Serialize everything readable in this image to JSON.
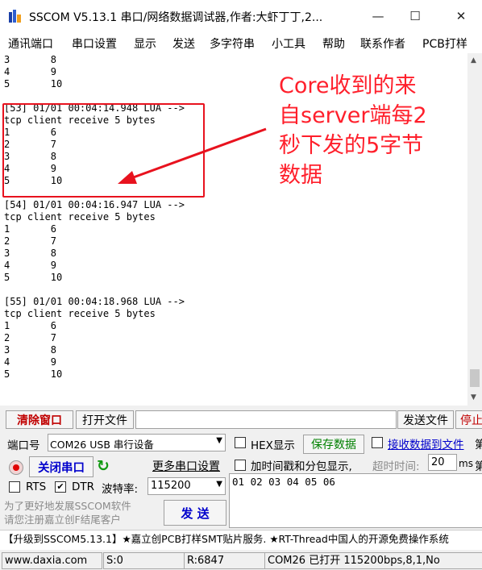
{
  "window": {
    "title": "SSCOM V5.13.1 串口/网络数据调试器,作者:大虾丁丁,2..."
  },
  "menu": [
    "通讯端口",
    "串口设置",
    "显示",
    "发送",
    "多字符串",
    "小工具",
    "帮助",
    "联系作者",
    "PCB打样"
  ],
  "log": "3       8\n4       9\n5       10\n\n[53] 01/01 00:04:14.948 LUA -->\ntcp client receive 5 bytes\n1       6\n2       7\n3       8\n4       9\n5       10\n\n[54] 01/01 00:04:16.947 LUA -->\ntcp client receive 5 bytes\n1       6\n2       7\n3       8\n4       9\n5       10\n\n[55] 01/01 00:04:18.968 LUA -->\ntcp client receive 5 bytes\n1       6\n2       7\n3       8\n4       9\n5       10",
  "annotation": "Core收到的来\n自server端每2\n秒下发的5字节\n数据",
  "toolbar": {
    "clear_window": "清除窗口",
    "open_file": "打开文件",
    "file_path": "",
    "send_file": "发送文件",
    "stop": "停止"
  },
  "port": {
    "label": "端口号",
    "value": "COM26 USB 串行设备",
    "close_port": "关闭串口",
    "more_settings": "更多串口设置",
    "rts": "RTS",
    "dtr": "DTR",
    "baud_label": "波特率:",
    "baud_value": "115200"
  },
  "options": {
    "hex_display": "HEX显示",
    "save_data": "保存数据",
    "receive_to_file": "接收数据到文件",
    "timestamp": "加时间戳和分包显示,",
    "timeout_label": "超时时间:",
    "timeout_value": "20",
    "timeout_unit": "ms",
    "extra": "第"
  },
  "send": {
    "data": "01 02 03 04 05 06",
    "promo": "为了更好地发展SSCOM软件\n请您注册嘉立创F结尾客户",
    "button": "发 送"
  },
  "ticker": "【升级到SSCOM5.13.1】★嘉立创PCB打样SMT贴片服务. ★RT-Thread中国人的开源免费操作系统",
  "status": {
    "site": "www.daxia.com",
    "sent": "S:0",
    "received": "R:6847",
    "port_state": "COM26 已打开  115200bps,8,1,No"
  },
  "colors": {
    "annotation": "#ff1f2b",
    "highlight_box": "#e8121e",
    "save_data_text": "#008000",
    "receive_to_file_text": "#0000cc"
  }
}
